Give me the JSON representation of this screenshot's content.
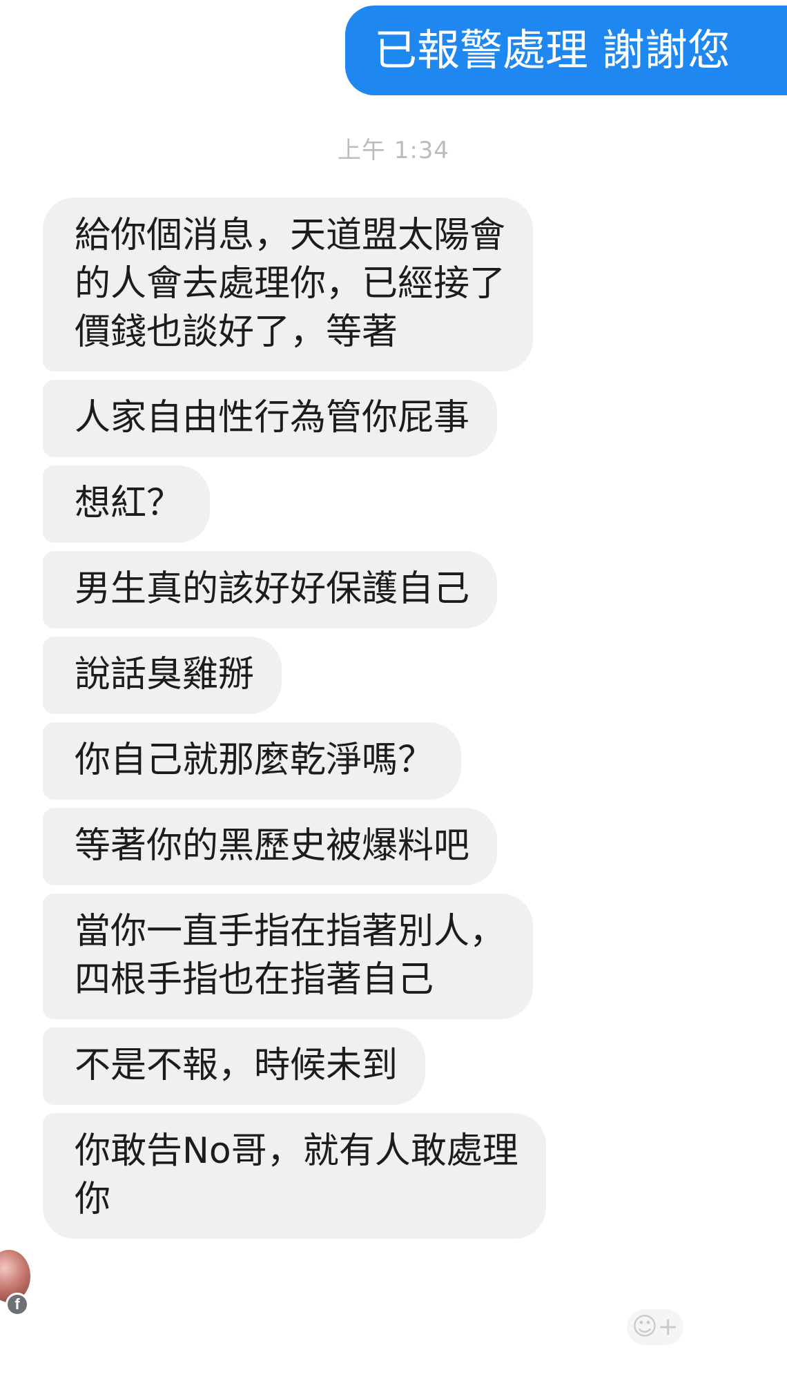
{
  "sent": {
    "text": "已報警處理 謝謝您",
    "color": "#1e87f0"
  },
  "timestamp": "上午 1:34",
  "received": [
    {
      "text": "給你個消息，天道盟太陽會\n的人會去處理你，已經接了\n價錢也談好了，等著"
    },
    {
      "text": "人家自由性行為管你屁事"
    },
    {
      "text": "想紅？"
    },
    {
      "text": "男生真的該好好保護自己"
    },
    {
      "text": "說話臭雞掰"
    },
    {
      "text": "你自己就那麼乾淨嗎？"
    },
    {
      "text": "等著你的黑歷史被爆料吧"
    },
    {
      "text": "當你一直手指在指著別人，\n四根手指也在指著自己"
    },
    {
      "text": "不是不報，時候未到"
    },
    {
      "text": "你敢告No哥，就有人敢處理\n你"
    }
  ],
  "icons": {
    "avatar": "contact-avatar",
    "badge": "facebook-icon",
    "badge_glyph": "f",
    "react": "add-reaction-icon",
    "react_glyph": "☺+"
  }
}
